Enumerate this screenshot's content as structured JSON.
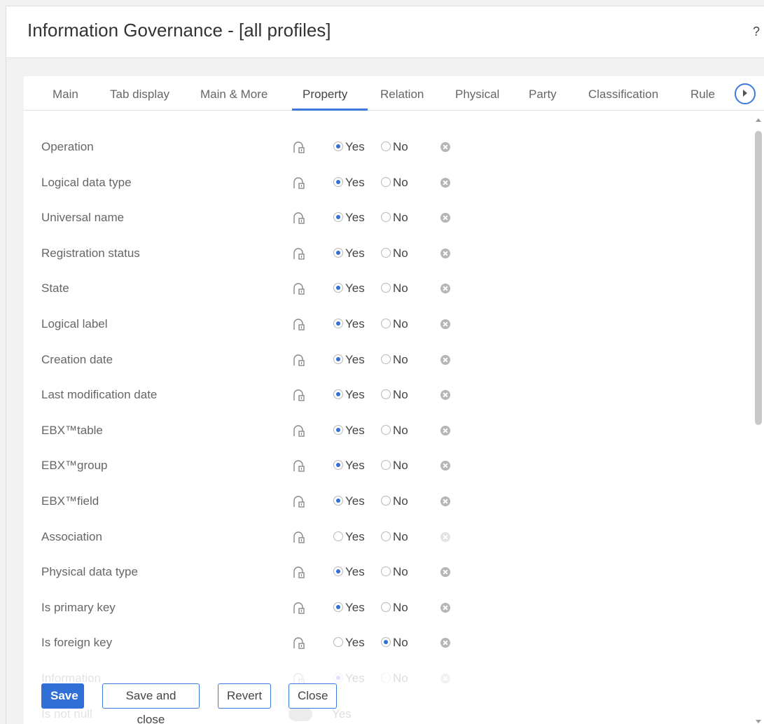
{
  "dialog": {
    "title": "Information Governance - [all profiles]",
    "help": "?"
  },
  "tabs": [
    {
      "label": "Main",
      "active": false
    },
    {
      "label": "Tab display",
      "active": false
    },
    {
      "label": "Main & More",
      "active": false
    },
    {
      "label": "Property",
      "active": true
    },
    {
      "label": "Relation",
      "active": false
    },
    {
      "label": "Physical",
      "active": false
    },
    {
      "label": "Party",
      "active": false
    },
    {
      "label": "Classification",
      "active": false
    },
    {
      "label": "Rule",
      "active": false
    }
  ],
  "options": {
    "yes": "Yes",
    "no": "No"
  },
  "rows": [
    {
      "label": "Operation",
      "value": "yes"
    },
    {
      "label": "Logical data type",
      "value": "yes"
    },
    {
      "label": "Universal name",
      "value": "yes"
    },
    {
      "label": "Registration status",
      "value": "yes"
    },
    {
      "label": "State",
      "value": "yes"
    },
    {
      "label": "Logical label",
      "value": "yes"
    },
    {
      "label": "Creation date",
      "value": "yes"
    },
    {
      "label": "Last modification date",
      "value": "yes"
    },
    {
      "label": "EBX™table",
      "value": "yes"
    },
    {
      "label": "EBX™group",
      "value": "yes"
    },
    {
      "label": "EBX™field",
      "value": "yes"
    },
    {
      "label": "Association",
      "value": "none"
    },
    {
      "label": "Physical data type",
      "value": "yes"
    },
    {
      "label": "Is primary key",
      "value": "yes"
    },
    {
      "label": "Is foreign key",
      "value": "no"
    },
    {
      "label": "Information",
      "value": "yes"
    },
    {
      "label": "Is not null",
      "value": "Yes"
    }
  ],
  "buttons": {
    "save": "Save",
    "save_close": "Save and close",
    "revert": "Revert",
    "close": "Close"
  },
  "colors": {
    "accent": "#2f6fd6"
  }
}
